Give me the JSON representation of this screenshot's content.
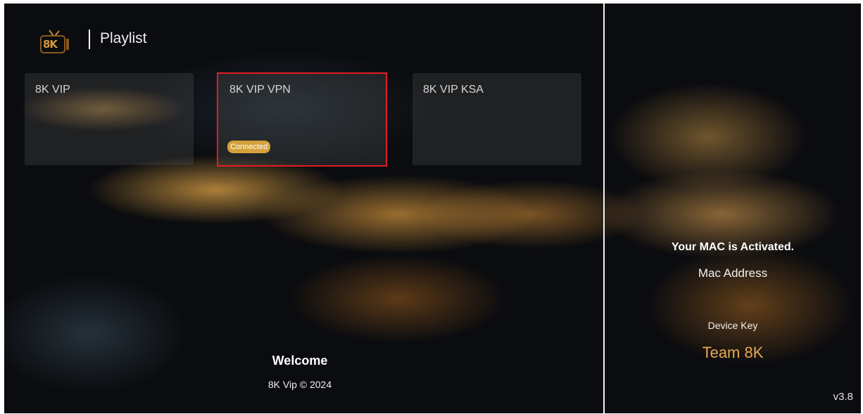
{
  "header": {
    "logo_text": "8K",
    "title": "Playlist"
  },
  "playlists": [
    {
      "label": "8K VIP"
    },
    {
      "label": "8K VIP VPN",
      "badge": "Connected",
      "selected": true
    },
    {
      "label": "8K VIP KSA"
    }
  ],
  "footer": {
    "welcome": "Welcome",
    "copyright": "8K Vip © 2024"
  },
  "side_panel": {
    "mac_status": "Your MAC is Activated.",
    "mac_label": "Mac Address",
    "device_key_label": "Device Key",
    "device_key_value": "Team 8K",
    "version": "v3.8"
  },
  "colors": {
    "accent": "#d4a13a",
    "selection_border": "#e21c24",
    "key_text": "#e8a850"
  },
  "icons": [
    "tv-logo-icon"
  ]
}
